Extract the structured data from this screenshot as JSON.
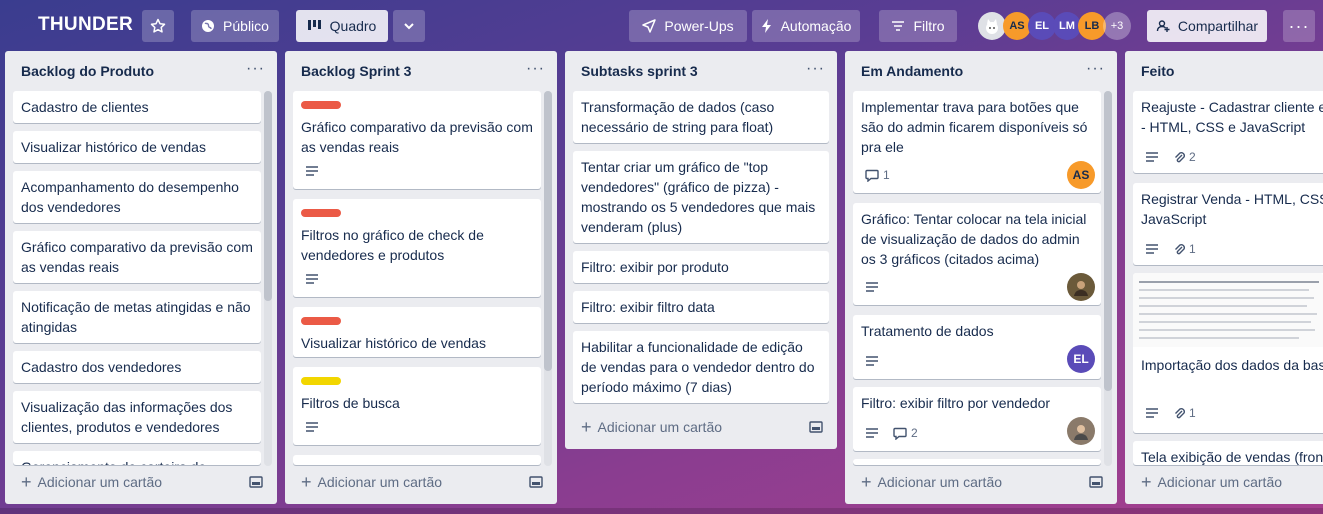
{
  "board": {
    "title": "THUNDER",
    "visibility_label": "Público",
    "view_label": "Quadro",
    "powerups_label": "Power-Ups",
    "automation_label": "Automação",
    "filter_label": "Filtro",
    "share_label": "Compartilhar",
    "extra_members": "+3",
    "members": [
      {
        "initials": "",
        "color": "#dfe1e6"
      },
      {
        "initials": "AS",
        "color": "#f79a2a"
      },
      {
        "initials": "EL",
        "color": "#5a4bb8"
      },
      {
        "initials": "LM",
        "color": "#5a4bb8"
      },
      {
        "initials": "LB",
        "color": "#f79a2a"
      }
    ]
  },
  "add_card_label": "Adicionar um cartão",
  "lists": [
    {
      "title": "Backlog do Produto",
      "cards": [
        "Cadastro de clientes",
        "Visualizar histórico de vendas",
        "Acompanhamento do desempenho dos vendedores",
        "Gráfico comparativo da previsão com as vendas reais",
        "Notificação de metas atingidas e não atingidas",
        "Cadastro dos vendedores",
        "Visualização das informações dos clientes, produtos e vendedores",
        "Gerenciamento de carteira de clientes"
      ]
    },
    {
      "title": "Backlog Sprint 3",
      "cards": [
        {
          "text": "Gráfico comparativo da previsão com as vendas reais",
          "label_color": "#eb5a46"
        },
        {
          "text": "Filtros no gráfico de check de vendedores e produtos",
          "label_color": "#eb5a46"
        },
        {
          "text": "Visualizar histórico de vendas",
          "label_color": "#eb5a46"
        },
        {
          "text": "Filtros de busca",
          "label_color": "#f2d600"
        }
      ]
    },
    {
      "title": "Subtasks sprint 3",
      "cards": [
        "Transformação de dados (caso necessário de string para float)",
        "Tentar criar um gráfico de \"top vendedores\" (gráfico de pizza) - mostrando os 5 vendedores que mais venderam (plus)",
        "Filtro: exibir por produto",
        "Filtro: exibir filtro data",
        "Habilitar a funcionalidade de edição de vendas para o vendedor dentro do período máximo (7 dias)"
      ]
    },
    {
      "title": "Em Andamento",
      "cards": [
        {
          "text": "Implementar trava para botões que são do admin ficarem disponíveis só pra ele",
          "comments": "1",
          "member": "AS",
          "member_color": "#f79a2a"
        },
        {
          "text": "Gráfico: Tentar colocar na tela inicial de visualização de dados do admin os 3 gráficos (citados acima)",
          "member": "",
          "member_color": "#6b5a3a"
        },
        {
          "text": "Tratamento de dados",
          "member": "EL",
          "member_color": "#5a4bb8"
        },
        {
          "text": "Filtro: exibir filtro por vendedor",
          "comments": "2",
          "member": "",
          "member_color": "#8a7a6a"
        }
      ]
    },
    {
      "title": "Feito",
      "cards": [
        {
          "text": "Reajuste - Cadastrar cliente e vendedor - HTML, CSS e JavaScript",
          "attachments": "2"
        },
        {
          "text": "Registrar Venda - HTML, CSS e JavaScript",
          "attachments": "1"
        },
        {
          "text": "Importação dos dados da base pgadmin",
          "attachments": "1"
        },
        {
          "text": "Tela exibição de vendas (frontend)"
        }
      ]
    }
  ]
}
